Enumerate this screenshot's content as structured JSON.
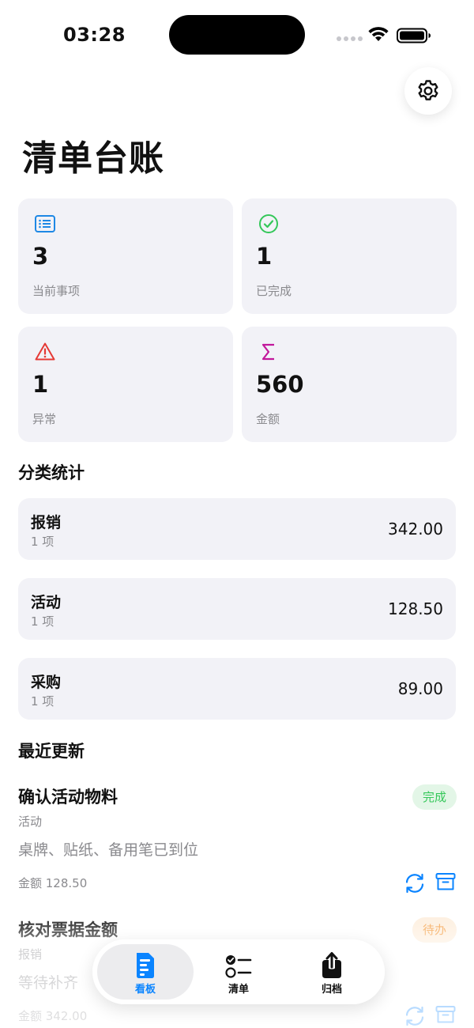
{
  "status_bar": {
    "time": "03:28"
  },
  "title": "清单台账",
  "stats": [
    {
      "value": "3",
      "label": "当前事项",
      "icon": "list-icon",
      "color": "#1e88e5"
    },
    {
      "value": "1",
      "label": "已完成",
      "icon": "checkmark-circle-icon",
      "color": "#34c759"
    },
    {
      "value": "1",
      "label": "异常",
      "icon": "warning-triangle-icon",
      "color": "#e53935"
    },
    {
      "value": "560",
      "label": "金额",
      "icon": "sigma-icon",
      "color": "#c2189b"
    }
  ],
  "categories_title": "分类统计",
  "categories": [
    {
      "name": "报销",
      "count": "1 项",
      "amount": "342.00"
    },
    {
      "name": "活动",
      "count": "1 项",
      "amount": "128.50"
    },
    {
      "name": "采购",
      "count": "1 项",
      "amount": "89.00"
    }
  ],
  "recent_title": "最近更新",
  "recent": [
    {
      "title": "确认活动物料",
      "category": "活动",
      "note": "桌牌、贴纸、备用笔已到位",
      "amount": "金额 128.50",
      "status": "完成"
    },
    {
      "title": "核对票据金额",
      "category": "报销",
      "note": "等待补齐",
      "amount": "金额 342.00",
      "status": "待办"
    }
  ],
  "tabs": [
    {
      "label": "看板",
      "icon": "dashboard-icon",
      "active": true
    },
    {
      "label": "清单",
      "icon": "checklist-icon",
      "active": false
    },
    {
      "label": "归档",
      "icon": "share-upload-icon",
      "active": false
    }
  ],
  "colors": {
    "accent": "#0a84ff",
    "done": "#34c759",
    "todo": "#f5a14a"
  }
}
